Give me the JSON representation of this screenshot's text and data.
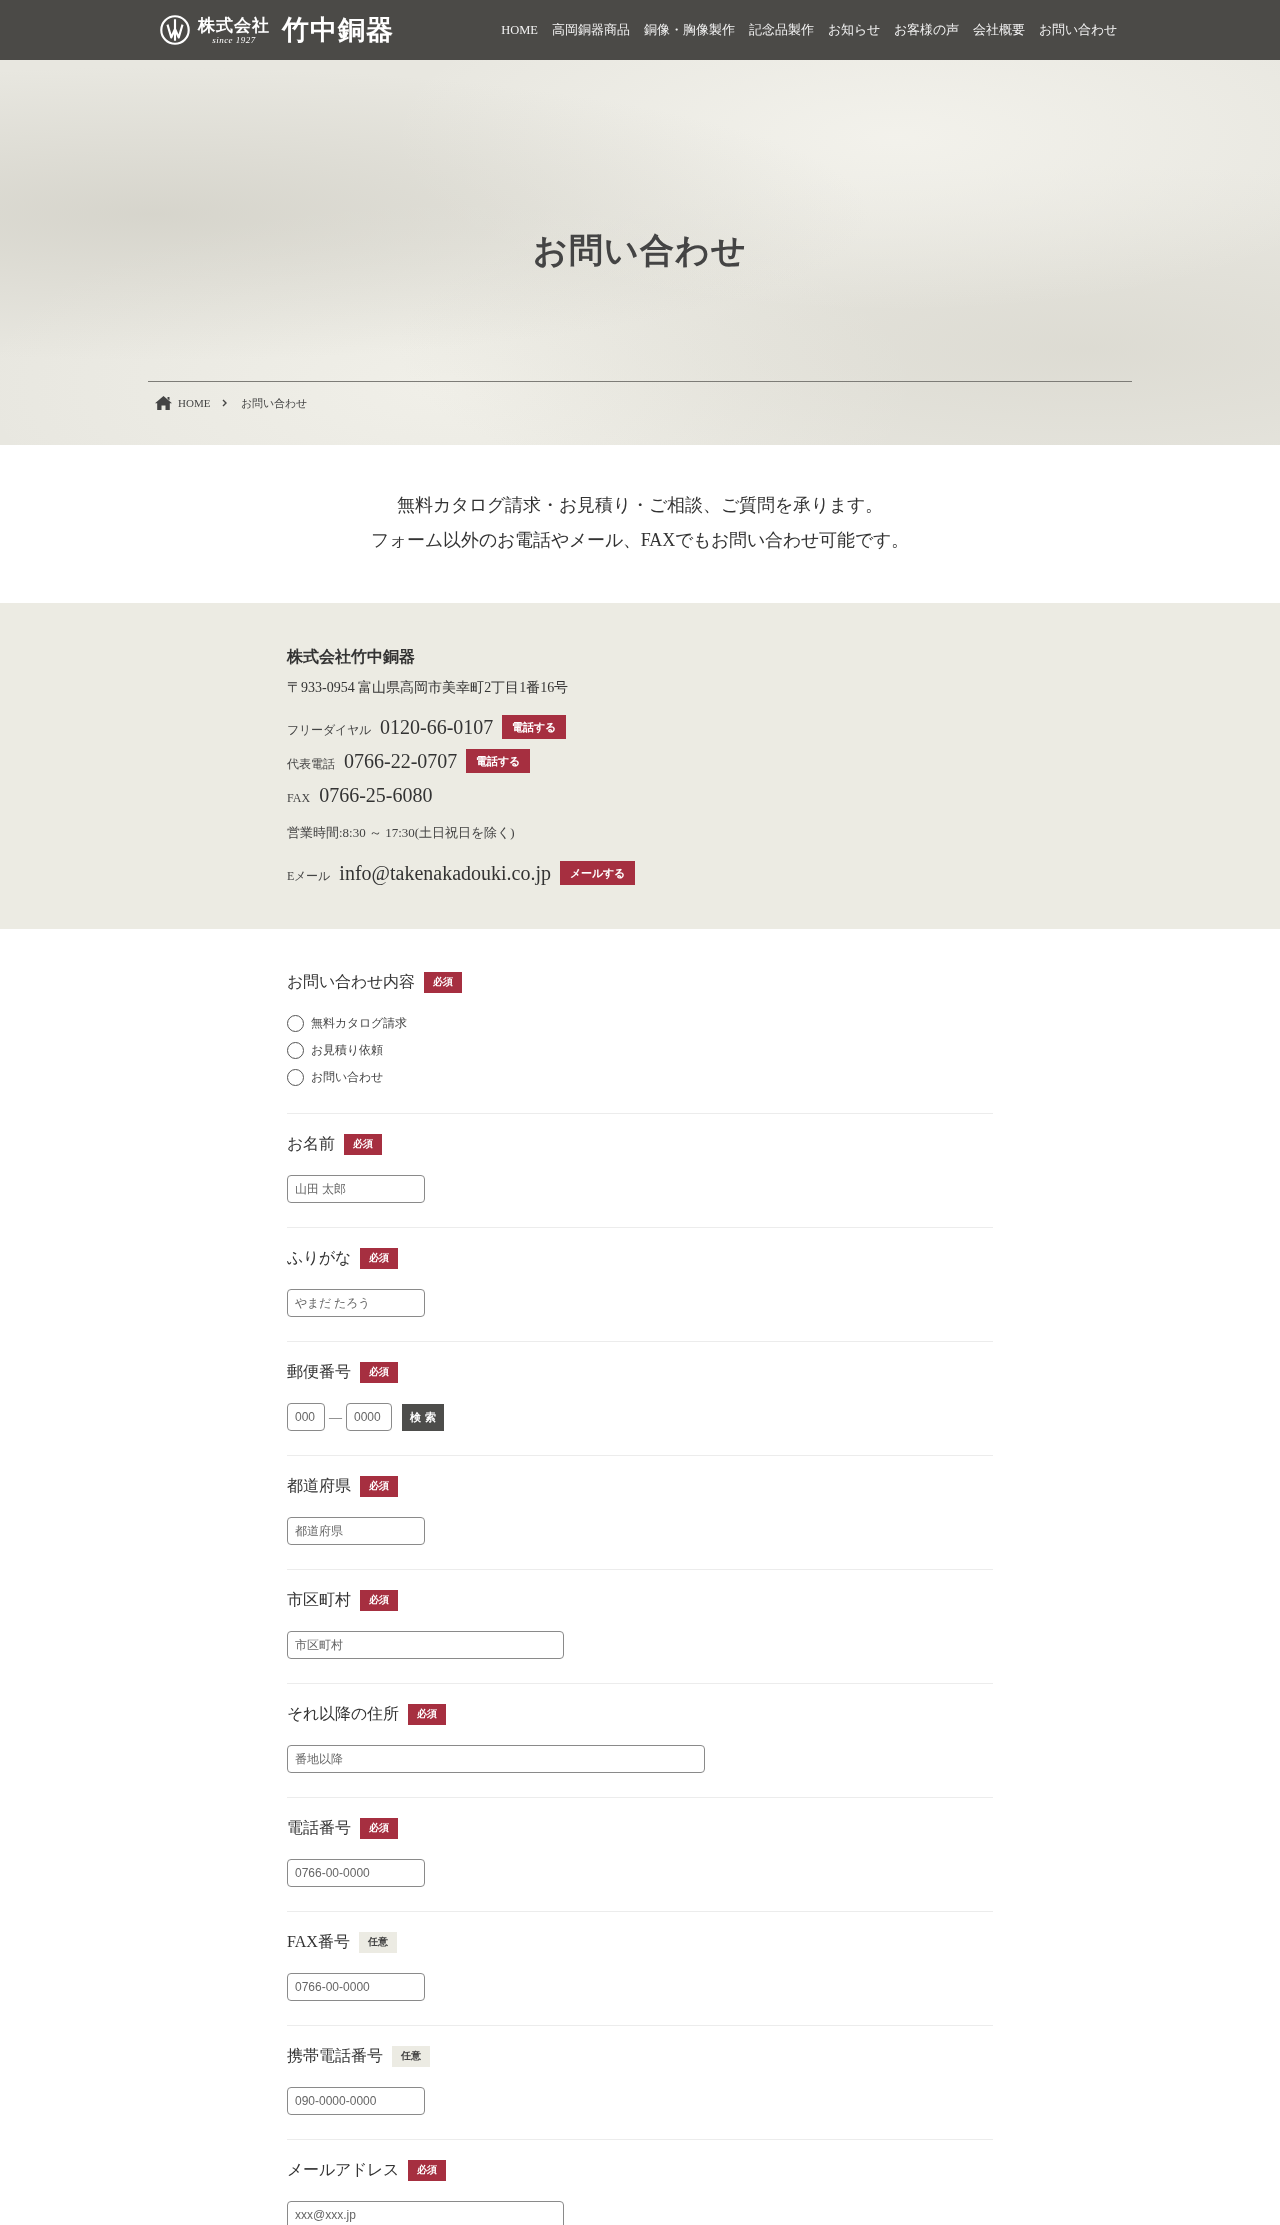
{
  "header": {
    "logo": {
      "prefix": "株式会社",
      "since": "since 1927",
      "name": "竹中銅器"
    },
    "nav": [
      "HOME",
      "高岡銅器商品",
      "銅像・胸像製作",
      "記念品製作",
      "お知らせ",
      "お客様の声",
      "会社概要",
      "お問い合わせ"
    ]
  },
  "hero": {
    "title": "お問い合わせ",
    "breadcrumb": {
      "home": "HOME",
      "current": "お問い合わせ"
    }
  },
  "intro": [
    "無料カタログ請求・お見積り・ご相談、ご質問を承ります。",
    "フォーム以外のお電話やメール、FAXでもお問い合わせ可能です。"
  ],
  "contact": {
    "company": "株式会社竹中銅器",
    "address": "〒933-0954 富山県高岡市美幸町2丁目1番16号",
    "phones": [
      {
        "label": "フリーダイヤル",
        "number": "0120-66-0107",
        "action": "電話する"
      },
      {
        "label": "代表電話",
        "number": "0766-22-0707",
        "action": "電話する"
      },
      {
        "label": "FAX",
        "number": "0766-25-6080"
      }
    ],
    "hours": "営業時間:8:30 ～ 17:30(土日祝日を除く)",
    "email": {
      "label": "Eメール",
      "address": "info@takenakadouki.co.jp",
      "action": "メールする"
    }
  },
  "form": {
    "fields": [
      {
        "kind": "radio",
        "label": "お問い合わせ内容",
        "badge": "必須",
        "required": true,
        "options": [
          {
            "label": "無料カタログ請求",
            "selected": false
          },
          {
            "label": "お見積り依頼",
            "selected": false
          },
          {
            "label": "お問い合わせ",
            "selected": false
          }
        ]
      },
      {
        "kind": "text",
        "label": "お名前",
        "badge": "必須",
        "required": true,
        "placeholder": "山田 太郎"
      },
      {
        "kind": "text",
        "label": "ふりがな",
        "badge": "必須",
        "required": true,
        "placeholder": "やまだ たろう"
      },
      {
        "kind": "postal",
        "label": "郵便番号",
        "badge": "必須",
        "required": true,
        "placeholders": [
          "000",
          "0000"
        ],
        "separator": "—",
        "button": "検 索"
      },
      {
        "kind": "text",
        "label": "都道府県",
        "badge": "必須",
        "required": true,
        "placeholder": "都道府県"
      },
      {
        "kind": "city",
        "label": "市区町村",
        "badge": "必須",
        "required": true,
        "placeholder": "市区町村"
      },
      {
        "kind": "street",
        "label": "それ以降の住所",
        "badge": "必須",
        "required": true,
        "placeholder": "番地以降"
      },
      {
        "kind": "tel",
        "label": "電話番号",
        "badge": "必須",
        "required": true,
        "placeholder": "0766-00-0000"
      },
      {
        "kind": "tel",
        "label": "FAX番号",
        "badge": "任意",
        "required": false,
        "placeholder": "0766-00-0000"
      },
      {
        "kind": "tel",
        "label": "携帯電話番号",
        "badge": "任意",
        "required": false,
        "placeholder": "090-0000-0000"
      },
      {
        "kind": "email",
        "label": "メールアドレス",
        "badge": "必須",
        "required": true,
        "placeholder": "xxx@xxx.jp"
      }
    ]
  }
}
